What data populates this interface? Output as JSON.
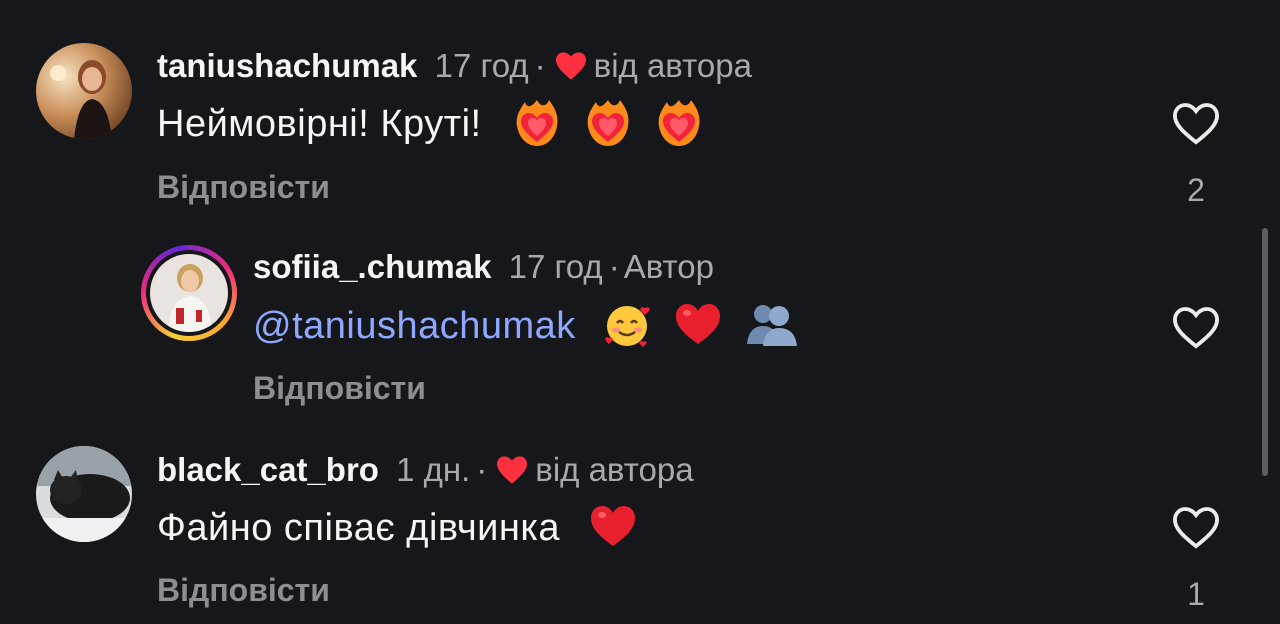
{
  "comments": [
    {
      "username": "taniushachumak",
      "time": "17 год",
      "separator": "·",
      "tag": "від автора",
      "liked_by_author": true,
      "text": "Неймовірні! Круті!",
      "emoji": [
        "heart-on-fire-icon",
        "heart-on-fire-icon",
        "heart-on-fire-icon"
      ],
      "reply_label": "Відповісти",
      "like_count": "2",
      "colors": {
        "heart": "#ff3040"
      }
    },
    {
      "username": "sofiia_.chumak",
      "time": "17 год",
      "separator": "·",
      "tag": "Автор",
      "mention": "@taniushachumak",
      "emoji": [
        "smiling-face-with-hearts-icon",
        "red-heart-icon",
        "busts-in-silhouette-icon"
      ],
      "reply_label": "Відповісти",
      "like_count": ""
    },
    {
      "username": "black_cat_bro",
      "time": "1 дн.",
      "separator": "·",
      "tag": "від автора",
      "liked_by_author": true,
      "text": "Файно співає дівчинка",
      "emoji": [
        "red-heart-icon"
      ],
      "reply_label": "Відповісти",
      "like_count": "1"
    }
  ],
  "colors": {
    "background": "#16171b",
    "mention": "#8fa8ff",
    "secondary_text": "#a8a8ad"
  }
}
